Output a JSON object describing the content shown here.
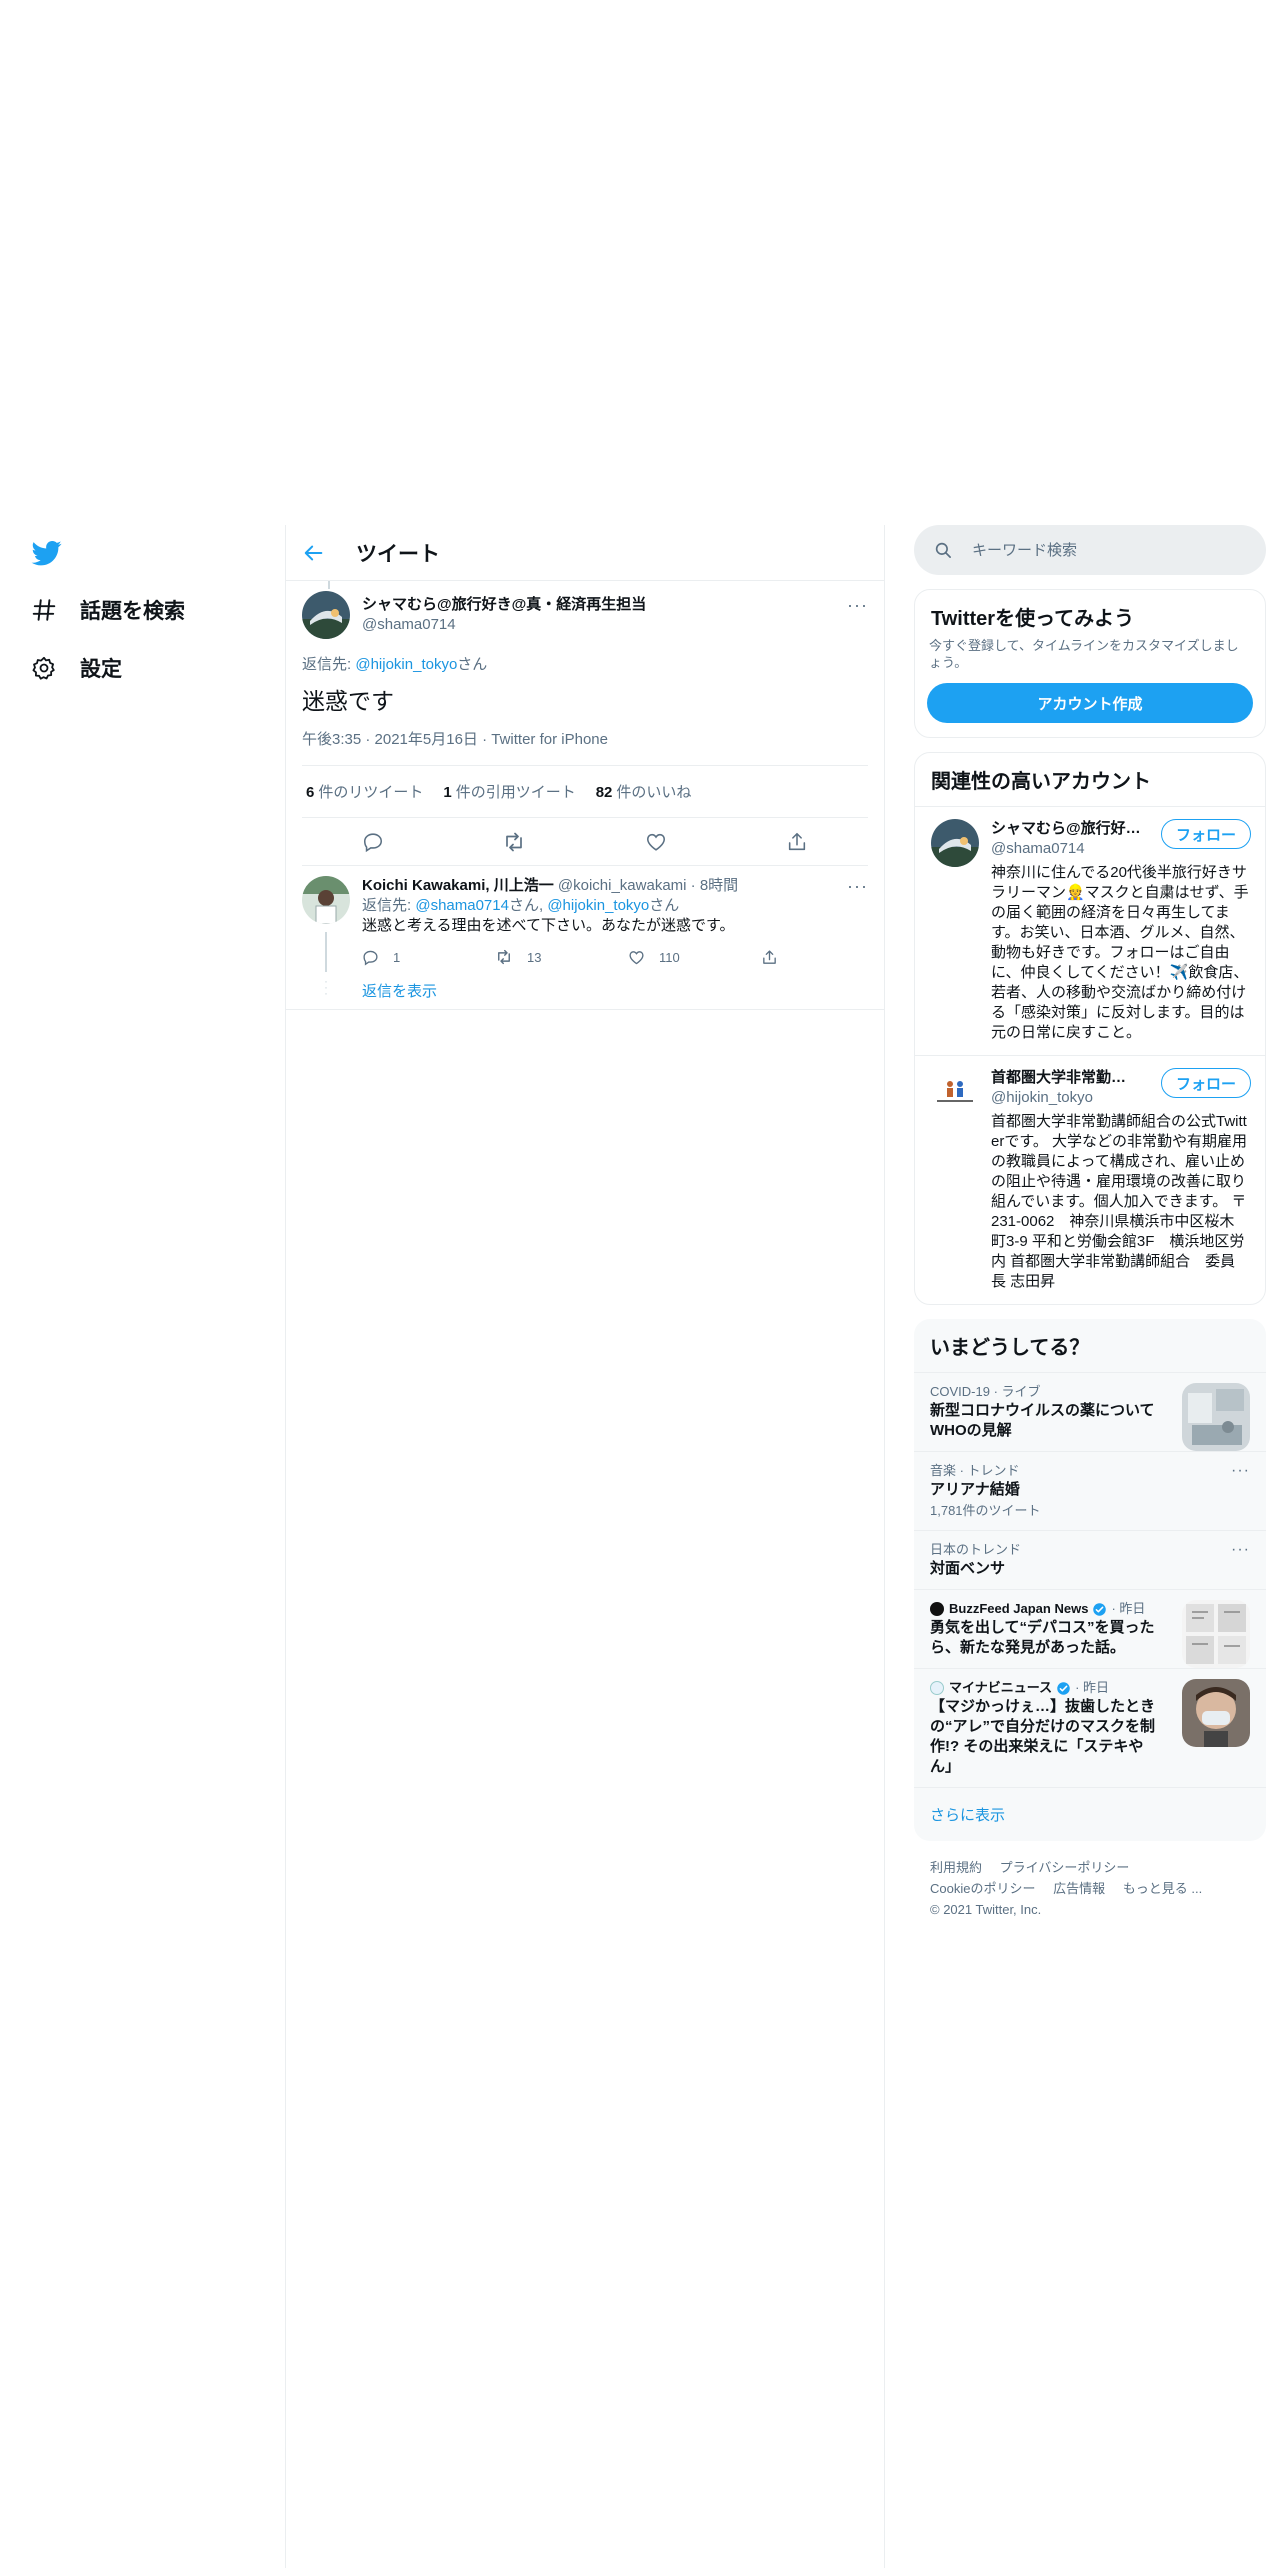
{
  "nav": {
    "explore_label": "話題を検索",
    "settings_label": "設定"
  },
  "header": {
    "title": "ツイート"
  },
  "tweet": {
    "author_name": "シャマむら@旅行好き@真・経済再生担当",
    "author_handle": "@shama0714",
    "reply_prefix": "返信先: ",
    "reply_to": "@hijokin_tokyo",
    "reply_suffix": "さん",
    "text": "迷惑です",
    "time": "午後3:35 · 2021年5月16日 · Twitter for iPhone",
    "retweets_count": "6",
    "retweets_label": "件のリツイート",
    "quotes_count": "1",
    "quotes_label": "件の引用ツイート",
    "likes_count": "82",
    "likes_label": "件のいいね"
  },
  "reply": {
    "name": "Koichi Kawakami, 川上浩一",
    "handle": "@koichi_kawakami",
    "time": "· 8時間",
    "reply_prefix": "返信先: ",
    "to1": "@shama0714",
    "mid": "さん, ",
    "to2": "@hijokin_tokyo",
    "suffix": "さん",
    "text": "迷惑と考える理由を述べて下さい。あなたが迷惑です。",
    "replies": "1",
    "retweets": "13",
    "likes": "110",
    "show_replies": "返信を表示"
  },
  "search": {
    "placeholder": "キーワード検索"
  },
  "signup": {
    "title": "Twitterを使ってみよう",
    "subtitle": "今すぐ登録して、タイムラインをカスタマイズしましょう。",
    "button": "アカウント作成"
  },
  "relevant": {
    "title": "関連性の高いアカウント",
    "follow_label": "フォロー",
    "accounts": [
      {
        "name": "シャマむら@旅行好き@真・経済再生担当",
        "handle": "@shama0714",
        "bio": "神奈川に住んでる20代後半旅行好きサラリーマン👷マスクと自粛はせず、手の届く範囲の経済を日々再生してます。お笑い、日本酒、グルメ、自然、動物も好きです。フォローはご自由に、仲良くしてください！✈️飲食店、若者、人の移動や交流ばかり締め付ける「感染対策」に反対します。目的は元の日常に戻すこと。"
      },
      {
        "name": "首都圏大学非常勤講師組合",
        "handle": "@hijokin_tokyo",
        "bio": "首都圏大学非常勤講師組合の公式Twitterです。 大学などの非常勤や有期雇用の教職員によって構成され、雇い止めの阻止や待遇・雇用環境の改善に取り組んでいます。個人加入できます。 〒231-0062　神奈川県横浜市中区桜木町3-9 平和と労働会館3F　横浜地区労内 首都圏大学非常勤講師組合　委員長 志田昇"
      }
    ]
  },
  "trends": {
    "title": "いまどうしてる？",
    "items": [
      {
        "meta": "COVID-19 · ライブ",
        "title": "新型コロナウイルスの薬についてWHOの見解",
        "count": ""
      },
      {
        "meta": "音楽 · トレンド",
        "title": "アリアナ結婚",
        "count": "1,781件のツイート"
      },
      {
        "meta": "日本のトレンド",
        "title": "対面ベンサ",
        "count": ""
      },
      {
        "source": "BuzzFeed Japan News",
        "time": "· 昨日",
        "title": "勇気を出して“デパコス”を買ったら、新たな発見があった話。"
      },
      {
        "source": "マイナビニュース",
        "time": "· 昨日",
        "title": "【マジかっけぇ…】抜歯したときの“アレ”で自分だけのマスクを制作!? その出来栄えに「ステキやん」"
      }
    ],
    "show_more": "さらに表示"
  },
  "footer": {
    "terms": "利用規約",
    "privacy": "プライバシーポリシー",
    "cookie": "Cookieのポリシー",
    "ads": "広告情報",
    "more": "もっと見る ...",
    "copyright": "© 2021 Twitter, Inc."
  },
  "colors": {
    "brand": "#1da1f2",
    "link": "#1b95e0",
    "muted": "#5b7083"
  }
}
